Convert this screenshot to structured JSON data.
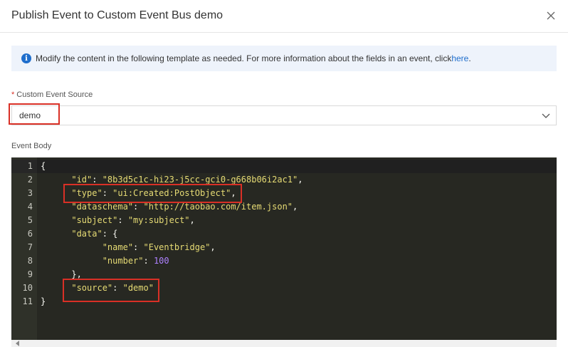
{
  "dialog": {
    "title": "Publish Event to Custom Event Bus demo"
  },
  "notice": {
    "text": "Modify the content in the following template as needed. For more information about the fields in an event, click ",
    "link": "here",
    "suffix": "."
  },
  "source_field": {
    "required_mark": "*",
    "label": "Custom Event Source",
    "value": "demo"
  },
  "body_field": {
    "label": "Event Body"
  },
  "editor": {
    "line_numbers": [
      "1",
      "2",
      "3",
      "4",
      "5",
      "6",
      "7",
      "8",
      "9",
      "10",
      "11"
    ],
    "lines": [
      {
        "parts": [
          {
            "t": "{",
            "c": "p"
          }
        ]
      },
      {
        "parts": [
          {
            "t": "      \"id\"",
            "c": "k"
          },
          {
            "t": ": ",
            "c": "p"
          },
          {
            "t": "\"8b3d5c1c-hi23-j5cc-gci0-g668b06i2ac1\"",
            "c": "s"
          },
          {
            "t": ",",
            "c": "p"
          }
        ]
      },
      {
        "parts": [
          {
            "t": "      \"type\"",
            "c": "k"
          },
          {
            "t": ": ",
            "c": "p"
          },
          {
            "t": "\"ui:Created:PostObject\"",
            "c": "s"
          },
          {
            "t": ",",
            "c": "p"
          }
        ]
      },
      {
        "parts": [
          {
            "t": "      \"dataschema\"",
            "c": "k"
          },
          {
            "t": ": ",
            "c": "p"
          },
          {
            "t": "\"http://taobao.com/item.json\"",
            "c": "s"
          },
          {
            "t": ",",
            "c": "p"
          }
        ]
      },
      {
        "parts": [
          {
            "t": "      \"subject\"",
            "c": "k"
          },
          {
            "t": ": ",
            "c": "p"
          },
          {
            "t": "\"my:subject\"",
            "c": "s"
          },
          {
            "t": ",",
            "c": "p"
          }
        ]
      },
      {
        "parts": [
          {
            "t": "      \"data\"",
            "c": "k"
          },
          {
            "t": ": {",
            "c": "p"
          }
        ]
      },
      {
        "parts": [
          {
            "t": "            \"name\"",
            "c": "k"
          },
          {
            "t": ": ",
            "c": "p"
          },
          {
            "t": "\"Eventbridge\"",
            "c": "s"
          },
          {
            "t": ",",
            "c": "p"
          }
        ]
      },
      {
        "parts": [
          {
            "t": "            \"number\"",
            "c": "k"
          },
          {
            "t": ": ",
            "c": "p"
          },
          {
            "t": "100",
            "c": "n"
          }
        ]
      },
      {
        "parts": [
          {
            "t": "      },",
            "c": "p"
          }
        ]
      },
      {
        "parts": [
          {
            "t": "      \"source\"",
            "c": "k"
          },
          {
            "t": ": ",
            "c": "p"
          },
          {
            "t": "\"demo\"",
            "c": "s"
          }
        ]
      },
      {
        "parts": [
          {
            "t": "}",
            "c": "p"
          }
        ]
      }
    ]
  },
  "colors": {
    "editor_bg": "#272822",
    "highlight_box": "#d93026",
    "link": "#1f6ecc"
  }
}
